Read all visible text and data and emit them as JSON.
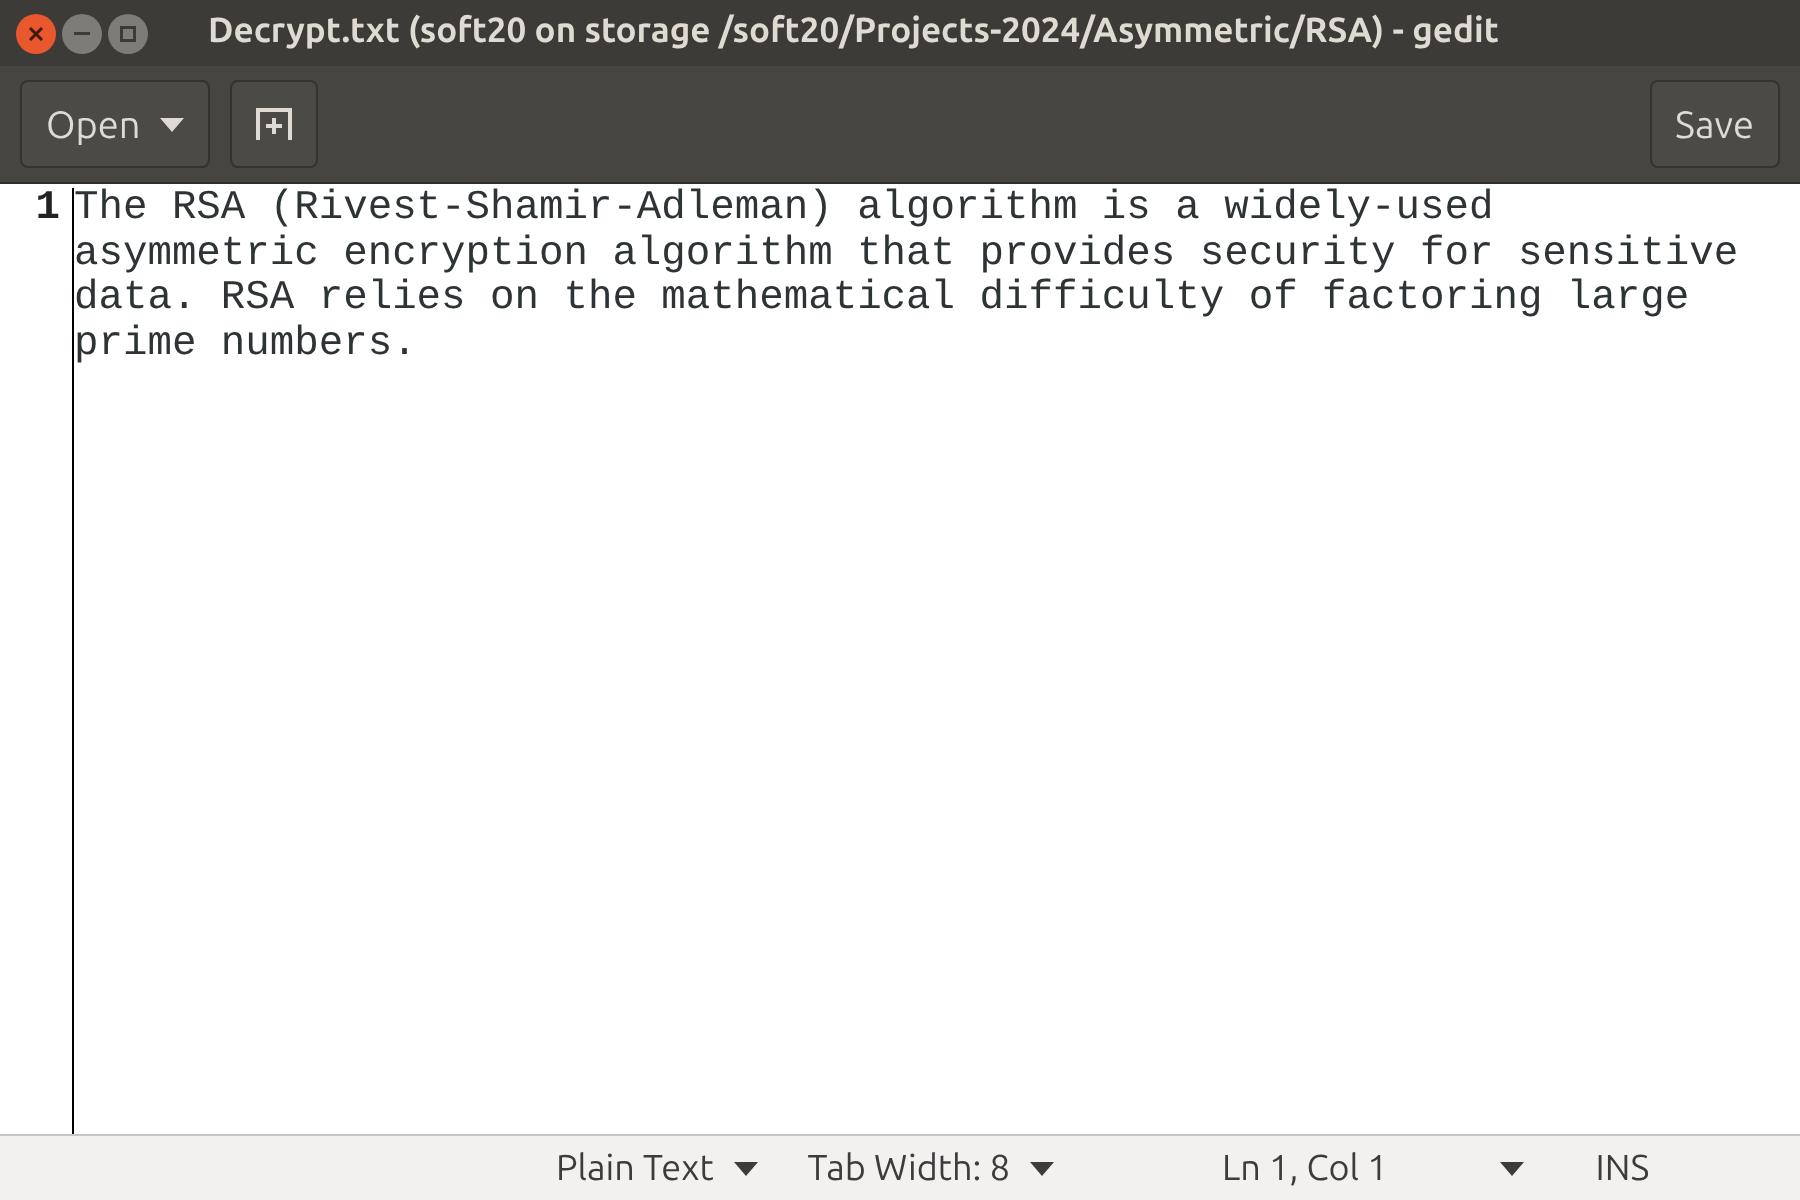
{
  "window": {
    "title": "Decrypt.txt (soft20 on storage /soft20/Projects-2024/Asymmetric/RSA) - gedit"
  },
  "toolbar": {
    "open_button": "Open",
    "save_button": "Save"
  },
  "editor": {
    "line_number": "1",
    "lines": [
      "The RSA (Rivest-Shamir-Adleman) algorithm is a widely-used",
      "asymmetric encryption algorithm that provides security for sensitive",
      "data. RSA relies on the mathematical difficulty of factoring large",
      "prime numbers."
    ]
  },
  "status_bar": {
    "language": "Plain Text",
    "tab_width": "Tab Width: 8",
    "position": "Ln 1, Col 1",
    "mode": "INS"
  }
}
